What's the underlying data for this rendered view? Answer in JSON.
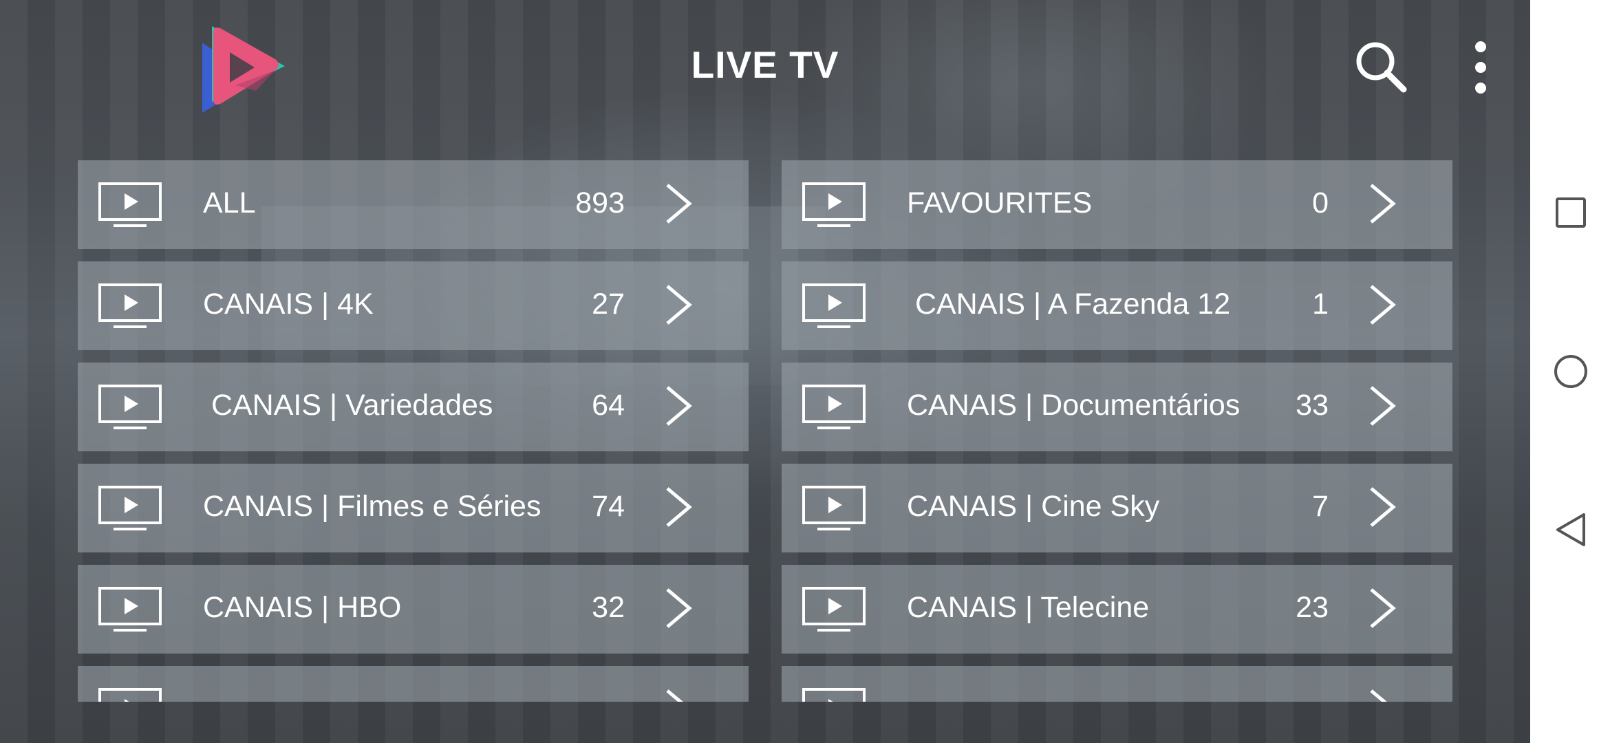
{
  "header": {
    "title": "LIVE TV",
    "logo_icon": "play-triangle-logo-icon",
    "search_icon": "search-icon",
    "menu_icon": "more-vertical-icon"
  },
  "colors": {
    "logo_pink": "#e8557c",
    "logo_teal": "#2bc4b4",
    "logo_blue": "#3a5fd1",
    "card_bg": "#969ea4",
    "text": "#ffffff"
  },
  "categories": [
    {
      "label": "ALL",
      "count": "893"
    },
    {
      "label": "FAVOURITES",
      "count": "0"
    },
    {
      "label": "CANAIS | 4K",
      "count": "27"
    },
    {
      "label": " CANAIS | A Fazenda 12",
      "count": "1"
    },
    {
      "label": " CANAIS | Variedades",
      "count": "64"
    },
    {
      "label": "CANAIS | Documentários",
      "count": "33"
    },
    {
      "label": "CANAIS | Filmes e Séries",
      "count": "74"
    },
    {
      "label": "CANAIS | Cine Sky",
      "count": "7"
    },
    {
      "label": "CANAIS | HBO",
      "count": "32"
    },
    {
      "label": "CANAIS | Telecine",
      "count": "23"
    },
    {
      "label": "",
      "count": ""
    },
    {
      "label": "",
      "count": ""
    }
  ],
  "navbar": {
    "recent_icon": "square-recents-icon",
    "home_icon": "circle-home-icon",
    "back_icon": "triangle-back-icon"
  }
}
